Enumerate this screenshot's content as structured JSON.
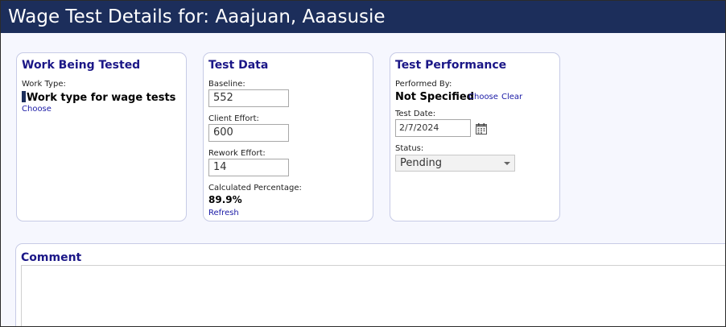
{
  "window": {
    "title": "Wage Test Details for:  Aaajuan, Aaasusie"
  },
  "work_being_tested": {
    "title": "Work Being Tested",
    "work_type_label": "Work Type:",
    "work_type_value": "Work type for wage tests",
    "choose_link": "Choose"
  },
  "test_data": {
    "title": "Test Data",
    "baseline_label": "Baseline:",
    "baseline_value": "552",
    "client_effort_label": "Client Effort:",
    "client_effort_value": "600",
    "rework_effort_label": "Rework Effort:",
    "rework_effort_value": "14",
    "calculated_percentage_label": "Calculated Percentage:",
    "calculated_percentage_value": "89.9%",
    "refresh_link": "Refresh"
  },
  "test_performance": {
    "title": "Test Performance",
    "performed_by_label": "Performed By:",
    "performed_by_value": "Not Specified",
    "choose_link": "Choose",
    "clear_link": "Clear",
    "test_date_label": "Test Date:",
    "test_date_value": "2/7/2024",
    "status_label": "Status:",
    "status_value": "Pending",
    "calendar_icon": "calendar-icon"
  },
  "comment": {
    "title": "Comment",
    "value": ""
  },
  "colors": {
    "titlebar_bg": "#1c2e5b",
    "heading": "#1b1787",
    "link": "#1a1aa6",
    "page_bg": "#f6f7fe"
  }
}
